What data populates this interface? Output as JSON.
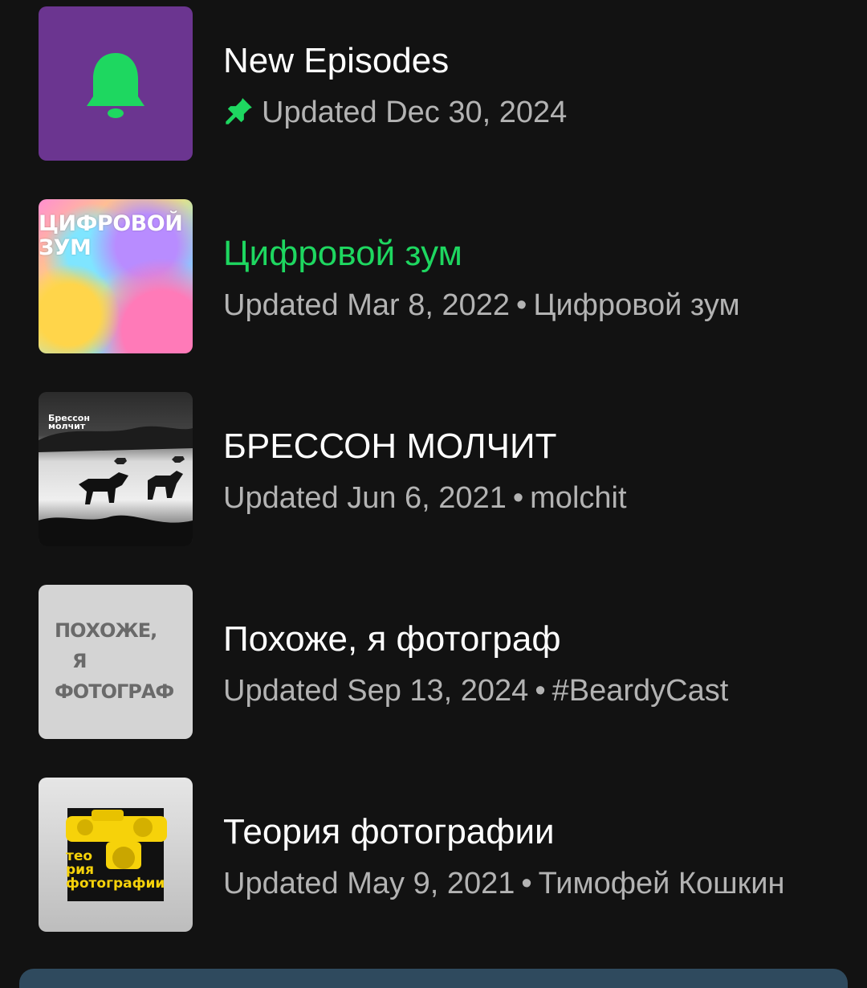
{
  "colors": {
    "background": "#121212",
    "accent_green": "#1ed760",
    "subtext": "#b3b3b3",
    "new_episodes_tile": "#6b3590",
    "bottom_bar": "#2f4a5e"
  },
  "items": [
    {
      "title": "New Episodes",
      "subtitle": "Updated Dec 30, 2024",
      "author": "",
      "pinned": true,
      "icon": "bell-icon",
      "active": false
    },
    {
      "title": "Цифровой зум",
      "subtitle": "Updated Mar 8, 2022",
      "author": "Цифровой зум",
      "cover_text": [
        "ЦИФРОВОЙ",
        "ЗУМ"
      ],
      "active": true
    },
    {
      "title": "БРЕССОН МОЛЧИТ",
      "subtitle": "Updated Jun 6, 2021",
      "author": "molchit",
      "cover_text": [
        "Брессон",
        "молчит"
      ],
      "active": false
    },
    {
      "title": "Похоже, я фотограф",
      "subtitle": "Updated Sep 13, 2024",
      "author": "#BeardyCast",
      "cover_text": [
        "ПОХОЖЕ,",
        "Я",
        "ФОТОГРАФ"
      ],
      "active": false
    },
    {
      "title": "Теория фотографии",
      "subtitle": "Updated May 9, 2021",
      "author": "Тимофей Кошкин",
      "cover_text": [
        "тео",
        "рия",
        "фотографии"
      ],
      "active": false
    }
  ],
  "separator": "•"
}
